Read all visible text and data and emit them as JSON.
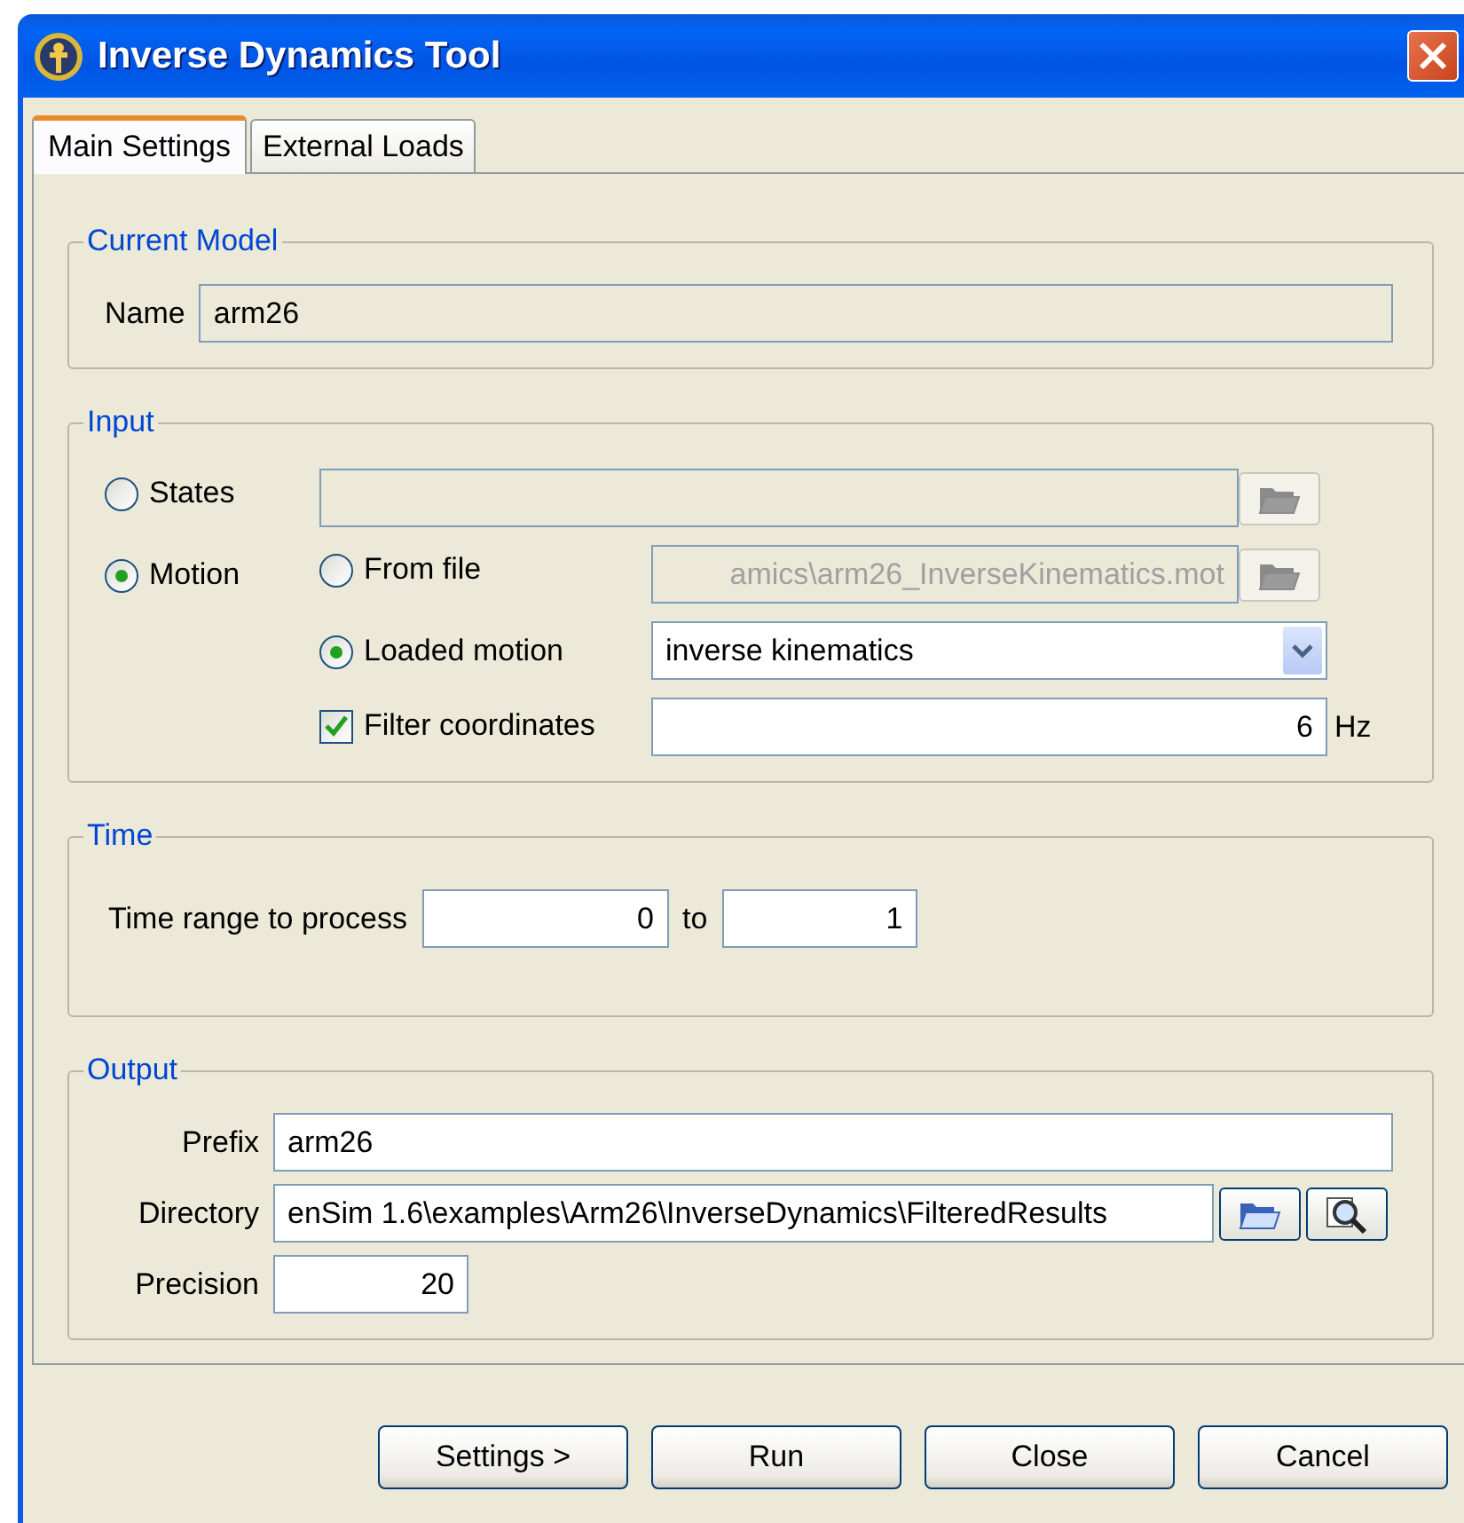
{
  "window": {
    "title": "Inverse Dynamics Tool"
  },
  "tabs": [
    {
      "label": "Main Settings",
      "selected": true
    },
    {
      "label": "External Loads",
      "selected": false
    }
  ],
  "current_model": {
    "title": "Current Model",
    "name_label": "Name",
    "name_value": "arm26"
  },
  "input": {
    "title": "Input",
    "states": {
      "label": "States",
      "selected": false
    },
    "motion": {
      "label": "Motion",
      "selected": true
    },
    "from_file": {
      "label": "From file",
      "selected": false,
      "value": "amics\\arm26_InverseKinematics.mot"
    },
    "loaded_motion": {
      "label": "Loaded motion",
      "selected": true,
      "value": "inverse kinematics"
    },
    "filter": {
      "label": "Filter coordinates",
      "checked": true,
      "value": "6",
      "unit": "Hz"
    }
  },
  "time": {
    "title": "Time",
    "label": "Time range to process",
    "from": "0",
    "to_label": "to",
    "to": "1"
  },
  "output": {
    "title": "Output",
    "prefix_label": "Prefix",
    "prefix": "arm26",
    "directory_label": "Directory",
    "directory": "enSim 1.6\\examples\\Arm26\\InverseDynamics\\FilteredResults",
    "precision_label": "Precision",
    "precision": "20"
  },
  "buttons": [
    "Settings >",
    "Run",
    "Close",
    "Cancel"
  ]
}
